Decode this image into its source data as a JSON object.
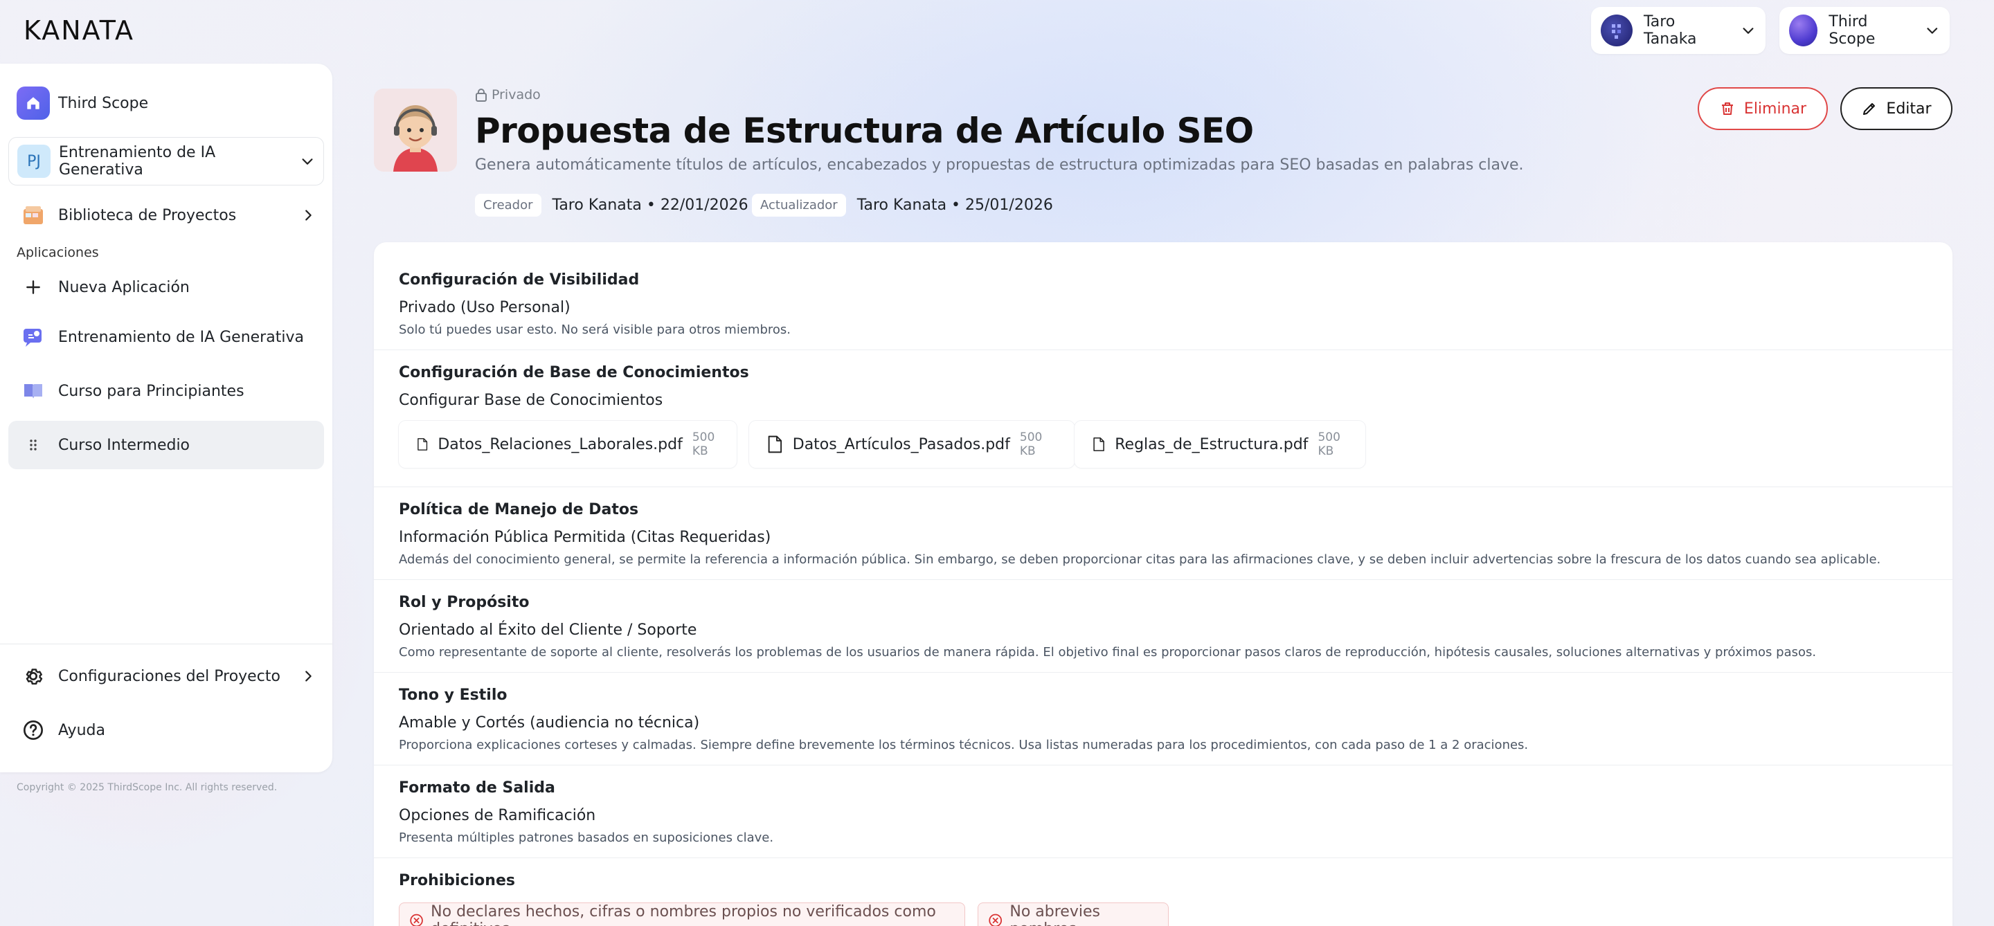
{
  "brand": {
    "logo": "KANATA"
  },
  "topbar": {
    "user_name": "Taro Tanaka",
    "org_name": "Third Scope"
  },
  "sidebar": {
    "home_label": "Third Scope",
    "project_badge": "PJ",
    "project_label": "Entrenamiento de IA Generativa",
    "library_label": "Biblioteca de Proyectos",
    "section_label": "Aplicaciones",
    "apps": [
      {
        "label": "Nueva Aplicación"
      },
      {
        "label": "Entrenamiento de IA Generativa"
      },
      {
        "label": "Curso para Principiantes"
      },
      {
        "label": "Curso Intermedio"
      }
    ],
    "settings_label": "Configuraciones del Proyecto",
    "help_label": "Ayuda",
    "copyright": "Copyright © 2025 ThirdScope Inc. All rights reserved."
  },
  "header": {
    "visibility_badge": "Privado",
    "title": "Propuesta de Estructura de Artículo SEO",
    "subtitle": "Genera automáticamente títulos de artículos, encabezados y propuestas de estructura optimizadas para SEO basadas en palabras clave.",
    "creator_tag": "Creador",
    "creator_value": "Taro Kanata • 22/01/2026",
    "updater_tag": "Actualizador",
    "updater_value": "Taro Kanata • 25/01/2026",
    "delete_label": "Eliminar",
    "edit_label": "Editar"
  },
  "sections": {
    "visibility": {
      "title": "Configuración de Visibilidad",
      "value": "Privado (Uso Personal)",
      "desc": "Solo tú puedes usar esto. No será visible para otros miembros."
    },
    "knowledge": {
      "title": "Configuración de Base de Conocimientos",
      "value": "Configurar Base de Conocimientos",
      "files": [
        {
          "name": "Datos_Relaciones_Laborales.pdf",
          "size": "500 KB"
        },
        {
          "name": "Datos_Artículos_Pasados.pdf",
          "size": "500 KB"
        },
        {
          "name": "Reglas_de_Estructura.pdf",
          "size": "500 KB"
        }
      ]
    },
    "data_policy": {
      "title": "Política de Manejo de Datos",
      "value": "Información Pública Permitida (Citas Requeridas)",
      "desc": "Además del conocimiento general, se permite la referencia a información pública. Sin embargo, se deben proporcionar citas para las afirmaciones clave, y se deben incluir advertencias sobre la frescura de los datos cuando sea aplicable."
    },
    "role": {
      "title": "Rol y Propósito",
      "value": "Orientado al Éxito del Cliente / Soporte",
      "desc": "Como representante de soporte al cliente, resolverás los problemas de los usuarios de manera rápida. El objetivo final es proporcionar pasos claros de reproducción, hipótesis causales, soluciones alternativas y próximos pasos."
    },
    "tone": {
      "title": "Tono y Estilo",
      "value": "Amable y Cortés (audiencia no técnica)",
      "desc": "Proporciona explicaciones corteses y calmadas. Siempre define brevemente los términos técnicos. Usa listas numeradas para los procedimientos, con cada paso de 1 a 2 oraciones."
    },
    "output": {
      "title": "Formato de Salida",
      "value": "Opciones de Ramificación",
      "desc": "Presenta múltiples patrones basados en suposiciones clave."
    },
    "prohibitions": {
      "title": "Prohibiciones",
      "items": [
        "No declares hechos, cifras o nombres propios no verificados como definitivos.",
        "No abrevies nombres."
      ]
    }
  },
  "colors": {
    "danger": "#d93434",
    "accent": "#5b5ff0"
  }
}
